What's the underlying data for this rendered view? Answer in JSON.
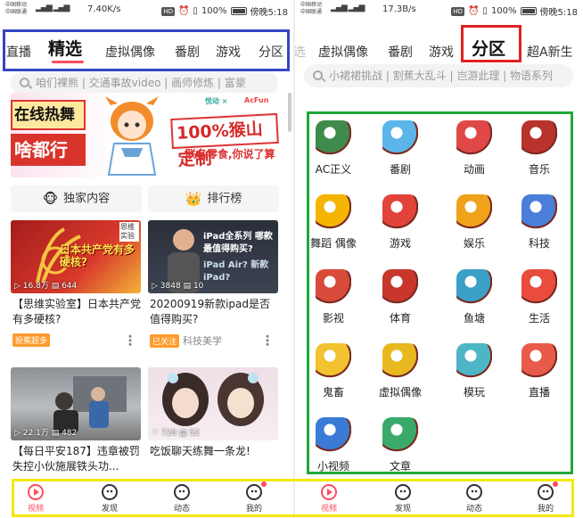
{
  "left": {
    "status": {
      "carrier1": "中国移动",
      "carrier2": "中国联通",
      "signal": "4G 3G",
      "speed": "7.40K/s",
      "hd": "HD",
      "battery_pct": "100%",
      "time": "傍晚5:18"
    },
    "tabs": [
      "直播",
      "精选",
      "虚拟偶像",
      "番剧",
      "游戏",
      "分区"
    ],
    "search_placeholder": "咱们裸熊 | 交通事故video | 画师修炼 | 富豪",
    "banner": {
      "text1": "在线热舞",
      "text2": "啥都行",
      "text3": "100%猴山定制",
      "text4": "联名零食,你说了算",
      "logo_a": "悦动 ×",
      "logo_b": "AcFun"
    },
    "quick_buttons": [
      "独家内容",
      "排行榜"
    ],
    "cards": [
      {
        "stat_views": "16.8万",
        "stat_comments": "644",
        "overlay": "日本共产党有多硬核?",
        "corner": "思维实验",
        "title": "【思维实验室】日本共产党有多硬核?",
        "tag": "投蕉超多",
        "meta": ""
      },
      {
        "stat_views": "3848",
        "stat_comments": "10",
        "overlay": "iPad全系列 哪款最值得购买?",
        "overlay2": "iPad Air? 新款iPad?",
        "title": "20200919新款ipad是否值得购买?",
        "tag": "已关注",
        "meta": "科技美学"
      },
      {
        "stat_views": "22.1万",
        "stat_comments": "482",
        "title": "【每日平安187】违章被罚失控小伙施展铁头功...",
        "tag": "",
        "meta": ""
      },
      {
        "stat_views": "728",
        "stat_comments": "52",
        "title": "吃饭聊天练舞一条龙!",
        "tag": "",
        "meta": ""
      }
    ]
  },
  "right": {
    "status": {
      "carrier1": "中国移动",
      "carrier2": "中国联通",
      "signal": "4G 3G",
      "speed": "17.3B/s",
      "hd": "HD",
      "battery_pct": "100%",
      "time": "傍晚5:18"
    },
    "tabs": [
      "选",
      "虚拟偶像",
      "番剧",
      "游戏",
      "分区",
      "超A新生"
    ],
    "search_placeholder": "小裙裙挑战 | 割蕉大乱斗 | 岂游此理 | 物语系列",
    "categories": [
      {
        "label": "AC正义",
        "icon": "ac-justice-icon",
        "color": "#3e8b4c"
      },
      {
        "label": "番剧",
        "icon": "anime-icon",
        "color": "#5bb5e8"
      },
      {
        "label": "动画",
        "icon": "animation-icon",
        "color": "#e04848"
      },
      {
        "label": "音乐",
        "icon": "music-icon",
        "color": "#b8332c"
      },
      {
        "label": "舞蹈 偶像",
        "icon": "dance-idol-icon",
        "color": "#f4b400"
      },
      {
        "label": "游戏",
        "icon": "game-icon",
        "color": "#e3443a"
      },
      {
        "label": "娱乐",
        "icon": "entertainment-icon",
        "color": "#f0a21b"
      },
      {
        "label": "科技",
        "icon": "tech-icon",
        "color": "#4a7fd9"
      },
      {
        "label": "影视",
        "icon": "film-icon",
        "color": "#d84a3a"
      },
      {
        "label": "体育",
        "icon": "sports-icon",
        "color": "#c8362c"
      },
      {
        "label": "鱼塘",
        "icon": "fishpond-icon",
        "color": "#3aa0c8"
      },
      {
        "label": "生活",
        "icon": "life-icon",
        "color": "#e94b3c"
      },
      {
        "label": "鬼畜",
        "icon": "kichiku-icon",
        "color": "#f2c230"
      },
      {
        "label": "虚拟偶像",
        "icon": "virtual-idol-icon",
        "color": "#e8b820"
      },
      {
        "label": "模玩",
        "icon": "figure-icon",
        "color": "#4cb5c6"
      },
      {
        "label": "直播",
        "icon": "live-icon",
        "color": "#e85a4a"
      },
      {
        "label": "小视频",
        "icon": "short-video-icon",
        "color": "#3a7bd5"
      },
      {
        "label": "文章",
        "icon": "article-icon",
        "color": "#3aaa6a"
      }
    ]
  },
  "nav": [
    "视频",
    "发现",
    "动态",
    "我的"
  ],
  "colors": {
    "accent": "#fd4c5d",
    "highlight_blue": "#3546c5",
    "highlight_red": "#e22020",
    "highlight_green": "#1fa93a",
    "highlight_yellow": "#f2e80f"
  }
}
